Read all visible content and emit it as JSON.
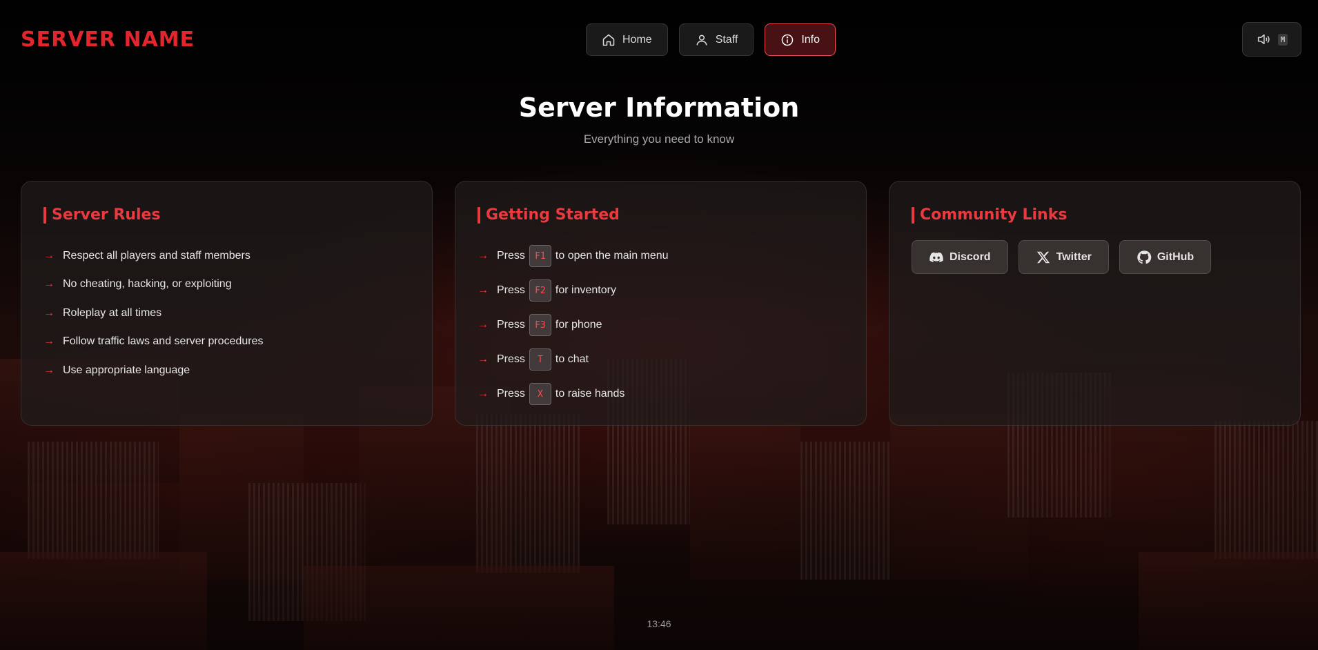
{
  "server_name": "SERVER NAME",
  "nav": [
    {
      "label": "Home",
      "icon": "home-icon"
    },
    {
      "label": "Staff",
      "icon": "user-icon"
    },
    {
      "label": "Info",
      "icon": "info-icon",
      "active": true
    }
  ],
  "sound": {
    "icon": "speaker-icon",
    "key": "M"
  },
  "heading": {
    "title": "Server Information",
    "subtitle": "Everything you need to know"
  },
  "rules": {
    "title": "Server Rules",
    "items": [
      "Respect all players and staff members",
      "No cheating, hacking, or exploiting",
      "Roleplay at all times",
      "Follow traffic laws and server procedures",
      "Use appropriate language"
    ]
  },
  "getting_started": {
    "title": "Getting Started",
    "steps": [
      {
        "prefix": "Press",
        "key": "F1",
        "text": "to open the main menu"
      },
      {
        "prefix": "Press",
        "key": "F2",
        "text": "for inventory"
      },
      {
        "prefix": "Press",
        "key": "F3",
        "text": "for phone"
      },
      {
        "prefix": "Press",
        "key": "T",
        "text": "to chat"
      },
      {
        "prefix": "Press",
        "key": "X",
        "text": "to raise hands"
      }
    ]
  },
  "community": {
    "title": "Community Links",
    "links": [
      {
        "label": "Discord",
        "icon": "discord-icon"
      },
      {
        "label": "Twitter",
        "icon": "x-twitter-icon"
      },
      {
        "label": "GitHub",
        "icon": "github-icon"
      }
    ]
  },
  "clock": "13:46",
  "colors": {
    "accent": "#ea3a40",
    "brand": "#e3262d",
    "background": "#0b0909"
  }
}
